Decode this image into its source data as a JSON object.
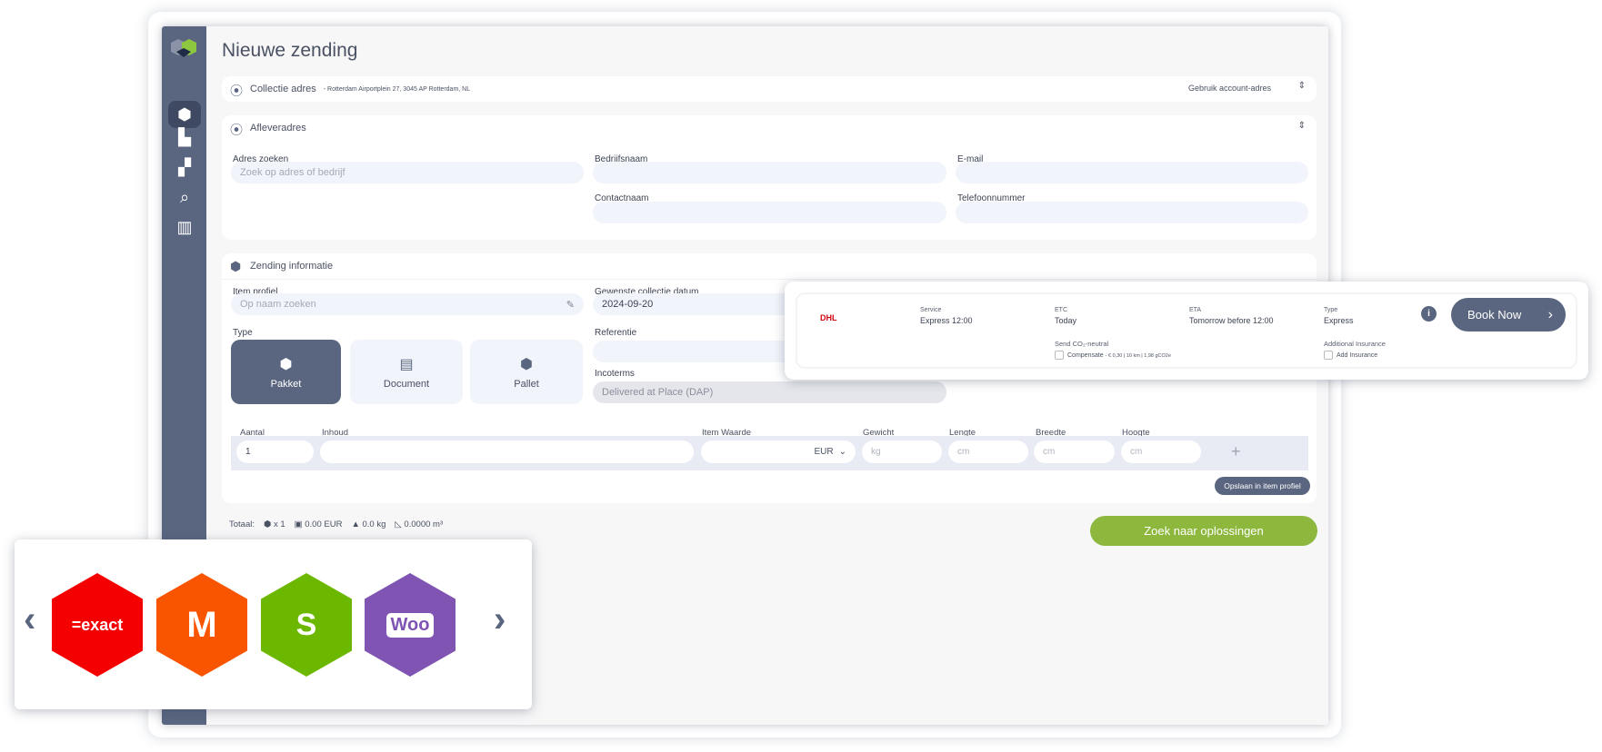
{
  "page": {
    "title": "Nieuwe zending"
  },
  "sidebar": {
    "items": [
      {
        "icon": "package-add-icon",
        "active": true
      },
      {
        "icon": "dashboard-icon"
      },
      {
        "icon": "boxes-icon"
      },
      {
        "icon": "track-search-icon"
      },
      {
        "icon": "bar-chart-icon"
      }
    ]
  },
  "collection": {
    "label": "Collectie adres",
    "address": "- Rotterdam Airportplein 27, 3045 AP Rotterdam, NL",
    "action": "Gebruik account-adres"
  },
  "delivery": {
    "label": "Afleveradres",
    "fields": {
      "search_label": "Adres zoeken",
      "search_placeholder": "Zoek op adres of bedrijf",
      "company_label": "Bedrijfsnaam",
      "email_label": "E-mail",
      "contact_label": "Contactnaam",
      "phone_label": "Telefoonnummer"
    }
  },
  "shipment": {
    "label": "Zending informatie",
    "item_profile_label": "Item profiel",
    "item_profile_placeholder": "Op naam zoeken",
    "type_label": "Type",
    "types": [
      "Pakket",
      "Document",
      "Pallet"
    ],
    "selected_type": "Pakket",
    "date_label": "Gewenste collectie datum",
    "date_value": "2024-09-20",
    "reference_label": "Referentie",
    "incoterms_label": "Incoterms",
    "incoterms_value": "Delivered at Place (DAP)",
    "table": {
      "headers": [
        "Aantal",
        "Inhoud",
        "Item Waarde",
        "Gewicht",
        "Lengte",
        "Breedte",
        "Hoogte"
      ],
      "quantity": "1",
      "currency": "EUR",
      "weight_placeholder": "kg",
      "length_placeholder": "cm",
      "width_placeholder": "cm",
      "height_placeholder": "cm"
    },
    "save_profile": "Opslaan in item profiel"
  },
  "totals": {
    "label": "Totaal:",
    "count": "x 1",
    "value": "0.00 EUR",
    "weight": "0.0 kg",
    "volume": "0.0000 m³"
  },
  "search_button": "Zoek naar oplossingen",
  "quote": {
    "carrier": "DHL",
    "carrier_color": "#d40511",
    "service_label": "Service",
    "service": "Express 12:00",
    "etc_label": "ETC",
    "etc": "Today",
    "eta_label": "ETA",
    "eta": "Tomorrow before 12:00",
    "type_label": "Type",
    "type": "Express",
    "co2_label": "Send CO₂-neutral",
    "co2_option": "Compensate",
    "co2_detail": "- € 0,30 | 10 km | 1,98 gCO2e",
    "insurance_label": "Additional Insurance",
    "insurance_option": "Add Insurance",
    "book": "Book Now"
  },
  "integrations": {
    "items": [
      {
        "name": "=exact",
        "color": "#f50000"
      },
      {
        "name": "Magento",
        "color": "#f95500"
      },
      {
        "name": "Shopify",
        "color": "#6cb800"
      },
      {
        "name": "Woo",
        "color": "#7f54b3"
      }
    ]
  }
}
